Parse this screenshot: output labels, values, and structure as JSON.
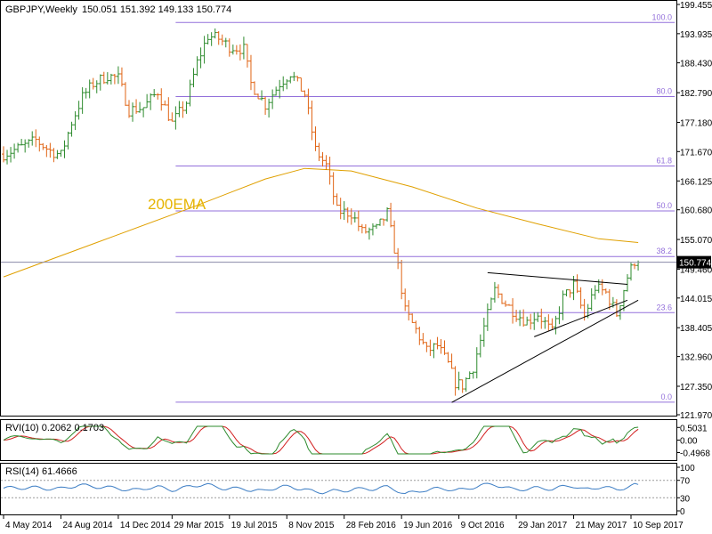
{
  "chart_data": {
    "type": "candlestick",
    "symbol_header": "GBPJPY,Weekly",
    "ohlc_header": "150.051 151.392 149.133 150.774",
    "current_price_label": "150.774",
    "current_price": 150.774,
    "annotation": "200EMA",
    "price_axis": {
      "ylim": [
        120.5,
        99.5
      ],
      "ylim_actual": [
        120.5,
        199.5
      ],
      "ticks": [
        199.455,
        193.935,
        188.43,
        182.79,
        177.18,
        171.67,
        166.125,
        160.68,
        155.07,
        149.46,
        144.015,
        138.405,
        132.96,
        127.35,
        121.97
      ],
      "tick_labels": [
        "199.455",
        "193.935",
        "188.430",
        "182.790",
        "177.180",
        "171.670",
        "166.125",
        "160.680",
        "155.070",
        "149.460",
        "144.015",
        "138.405",
        "132.960",
        "127.350",
        "121.970"
      ]
    },
    "time_axis": {
      "start": "2014-05-04",
      "end": "2017-09-24",
      "labels": [
        {
          "text": "4 May 2014",
          "date": "2014-05-04"
        },
        {
          "text": "24 Aug 2014",
          "date": "2014-08-24"
        },
        {
          "text": "14 Dec 2014",
          "date": "2014-12-14"
        },
        {
          "text": "29 Mar 2015",
          "date": "2015-03-29"
        },
        {
          "text": "19 Jul 2015",
          "date": "2015-07-19"
        },
        {
          "text": "8 Nov 2015",
          "date": "2015-11-08"
        },
        {
          "text": "28 Feb 2016",
          "date": "2016-02-28"
        },
        {
          "text": "19 Jun 2016",
          "date": "2016-06-19"
        },
        {
          "text": "9 Oct 2016",
          "date": "2016-10-09"
        },
        {
          "text": "29 Jan 2017",
          "date": "2017-01-29"
        },
        {
          "text": "21 May 2017",
          "date": "2017-05-21"
        },
        {
          "text": "10 Sep 2017",
          "date": "2017-09-10"
        }
      ]
    },
    "price_path": [
      [
        "2014-05-04",
        171.2
      ],
      [
        "2014-06-08",
        172.5
      ],
      [
        "2014-07-06",
        173.8
      ],
      [
        "2014-08-03",
        171.8
      ],
      [
        "2014-08-24",
        171.0
      ],
      [
        "2014-09-14",
        177.2
      ],
      [
        "2014-10-05",
        182.0
      ],
      [
        "2014-10-26",
        184.5
      ],
      [
        "2014-11-23",
        186.0
      ],
      [
        "2014-12-14",
        185.5
      ],
      [
        "2015-01-04",
        179.5
      ],
      [
        "2015-02-01",
        180.0
      ],
      [
        "2015-03-01",
        183.0
      ],
      [
        "2015-03-29",
        177.0
      ],
      [
        "2015-04-26",
        181.0
      ],
      [
        "2015-05-17",
        188.5
      ],
      [
        "2015-06-07",
        193.5
      ],
      [
        "2015-06-28",
        193.0
      ],
      [
        "2015-07-19",
        191.5
      ],
      [
        "2015-08-16",
        191.0
      ],
      [
        "2015-08-30",
        184.5
      ],
      [
        "2015-09-27",
        180.5
      ],
      [
        "2015-10-25",
        184.5
      ],
      [
        "2015-11-15",
        186.5
      ],
      [
        "2015-12-13",
        182.5
      ],
      [
        "2016-01-03",
        172.0
      ],
      [
        "2016-01-24",
        169.0
      ],
      [
        "2016-02-14",
        160.5
      ],
      [
        "2016-03-13",
        160.0
      ],
      [
        "2016-04-03",
        156.5
      ],
      [
        "2016-05-01",
        157.0
      ],
      [
        "2016-05-22",
        160.0
      ],
      [
        "2016-06-12",
        150.0
      ],
      [
        "2016-06-26",
        141.5
      ],
      [
        "2016-07-17",
        138.0
      ],
      [
        "2016-08-07",
        134.0
      ],
      [
        "2016-08-28",
        135.0
      ],
      [
        "2016-09-18",
        131.5
      ],
      [
        "2016-10-02",
        128.0
      ],
      [
        "2016-10-16",
        127.5
      ],
      [
        "2016-11-06",
        131.0
      ],
      [
        "2016-11-27",
        138.5
      ],
      [
        "2016-12-18",
        145.5
      ],
      [
        "2017-01-08",
        143.0
      ],
      [
        "2017-01-29",
        141.0
      ],
      [
        "2017-02-19",
        139.5
      ],
      [
        "2017-03-12",
        141.0
      ],
      [
        "2017-04-09",
        137.5
      ],
      [
        "2017-04-30",
        144.0
      ],
      [
        "2017-05-21",
        146.5
      ],
      [
        "2017-06-11",
        140.5
      ],
      [
        "2017-07-02",
        146.0
      ],
      [
        "2017-07-23",
        145.0
      ],
      [
        "2017-08-13",
        141.0
      ],
      [
        "2017-09-03",
        148.0
      ],
      [
        "2017-09-17",
        151.0
      ],
      [
        "2017-09-24",
        150.8
      ]
    ],
    "ema200_path": [
      [
        "2014-05-04",
        148.0
      ],
      [
        "2014-11-02",
        154.5
      ],
      [
        "2015-05-03",
        161.0
      ],
      [
        "2015-09-27",
        166.5
      ],
      [
        "2015-12-13",
        168.5
      ],
      [
        "2016-03-13",
        168.0
      ],
      [
        "2016-07-10",
        165.0
      ],
      [
        "2016-11-13",
        161.0
      ],
      [
        "2017-03-12",
        158.0
      ],
      [
        "2017-07-09",
        155.2
      ],
      [
        "2017-09-24",
        154.5
      ]
    ],
    "fibonacci": {
      "start": "2015-04-05",
      "levels": [
        {
          "label": "100.0",
          "price": 196.05
        },
        {
          "label": "80.0",
          "price": 182.05
        },
        {
          "label": "61.8",
          "price": 168.95
        },
        {
          "label": "50.0",
          "price": 160.45
        },
        {
          "label": "38.2",
          "price": 151.85
        },
        {
          "label": "23.6",
          "price": 141.25
        },
        {
          "label": "0.0",
          "price": 124.35
        }
      ]
    },
    "trendlines": [
      {
        "from": [
          "2016-09-25",
          124.3
        ],
        "to": [
          "2017-09-24",
          143.6
        ]
      },
      {
        "from": [
          "2016-12-04",
          148.8
        ],
        "to": [
          "2017-09-03",
          146.6
        ]
      },
      {
        "from": [
          "2017-03-05",
          136.7
        ],
        "to": [
          "2017-09-03",
          143.6
        ]
      }
    ],
    "rvi": {
      "header": "RVI(10) 0.2062 0.1703",
      "ylim": [
        -0.62,
        0.62
      ],
      "ticks": [
        0.5031,
        0.0,
        -0.4968
      ],
      "tick_labels": [
        "0.5031",
        "0.00",
        "-0.4968"
      ]
    },
    "rsi": {
      "header": "RSI(14) 61.4666",
      "ylim": [
        0,
        100
      ],
      "levels": [
        70,
        30
      ],
      "ticks": [
        100,
        70,
        30,
        0
      ],
      "tick_labels": [
        "100",
        "70",
        "30",
        "0"
      ]
    },
    "colors": {
      "bullish": "#2e8b2e",
      "bearish": "#e06414",
      "ema": "#e0a000",
      "fib": "#9370db",
      "rvi_main": "#2e8b2e",
      "rvi_signal": "#d22020",
      "rsi": "#3c7dc4",
      "price_tag": "#000000"
    }
  }
}
